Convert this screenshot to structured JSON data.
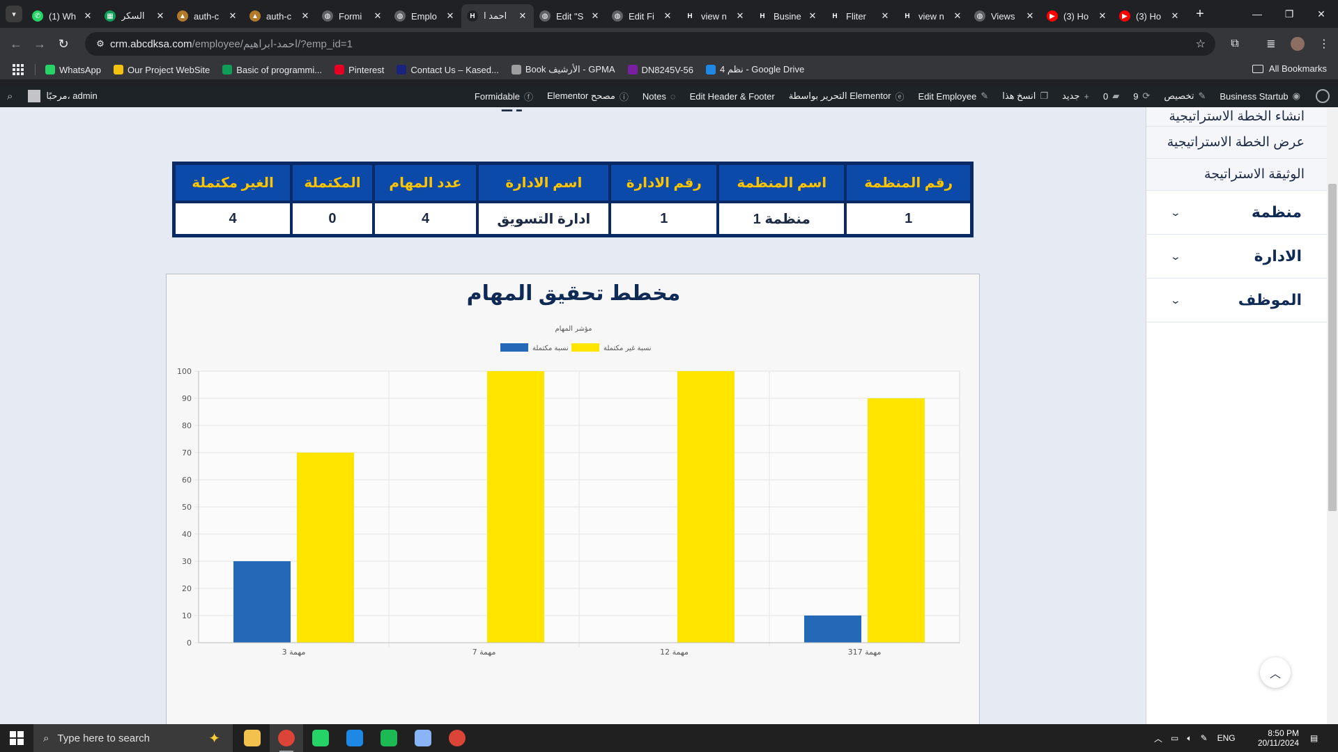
{
  "browser": {
    "tabs": [
      {
        "title": "(1) Wh",
        "icon": "whatsapp-icon",
        "color": "#25d366",
        "glyph": "✆"
      },
      {
        "title": "السكر",
        "icon": "sheets-icon",
        "color": "#0f9d58",
        "glyph": "▦"
      },
      {
        "title": "auth-c",
        "icon": "mountain-icon",
        "color": "#b07a2a",
        "glyph": "▲"
      },
      {
        "title": "auth-c",
        "icon": "mountain-icon",
        "color": "#b07a2a",
        "glyph": "▲"
      },
      {
        "title": "Formi",
        "icon": "globe-icon",
        "color": "#5f6368",
        "glyph": "◍"
      },
      {
        "title": "Emplo",
        "icon": "globe-icon",
        "color": "#5f6368",
        "glyph": "◍"
      },
      {
        "title": "احمد ا",
        "icon": "h-logo-icon",
        "color": "#202124",
        "glyph": "H",
        "active": true
      },
      {
        "title": "Edit \"S",
        "icon": "globe-icon",
        "color": "#5f6368",
        "glyph": "◍"
      },
      {
        "title": "Edit Fi",
        "icon": "globe-icon",
        "color": "#5f6368",
        "glyph": "◍"
      },
      {
        "title": "view n",
        "icon": "h-logo-icon",
        "color": "#202124",
        "glyph": "H"
      },
      {
        "title": "Busine",
        "icon": "h-logo-icon",
        "color": "#202124",
        "glyph": "H"
      },
      {
        "title": "Fliter",
        "icon": "h-logo-icon",
        "color": "#202124",
        "glyph": "H"
      },
      {
        "title": "view n",
        "icon": "h-logo-icon",
        "color": "#202124",
        "glyph": "H"
      },
      {
        "title": "Views",
        "icon": "globe-icon",
        "color": "#5f6368",
        "glyph": "◍"
      },
      {
        "title": "(3) Ho",
        "icon": "youtube-icon",
        "color": "#ff0000",
        "glyph": "▶"
      },
      {
        "title": "(3) Ho",
        "icon": "youtube-icon",
        "color": "#ff0000",
        "glyph": "▶"
      }
    ],
    "url_host": "crm.abcdksa.com",
    "url_path": "/employee/احمد-ابراهيم/?emp_id=1",
    "bookmarks": [
      {
        "label": "WhatsApp",
        "color": "#25d366"
      },
      {
        "label": "Our Project WebSite",
        "color": "#f4c20d"
      },
      {
        "label": "Basic of programmi...",
        "color": "#0f9d58"
      },
      {
        "label": "Pinterest",
        "color": "#e60023"
      },
      {
        "label": "Contact Us – Kased...",
        "color": "#1a237e"
      },
      {
        "label": "Book الأرشيف - GPMA",
        "color": "#9e9e9e"
      },
      {
        "label": "DN8245V-56",
        "color": "#7b1fa2"
      },
      {
        "label": "4 نظم - Google Drive",
        "color": "#1e88e5"
      }
    ],
    "all_bookmarks": "All Bookmarks"
  },
  "wp_admin_bar": {
    "greeting": "مرحبًا، admin",
    "items": [
      {
        "label": "Business Startub",
        "icon": "palette-icon"
      },
      {
        "label": "تخصيص",
        "icon": "brush-icon"
      },
      {
        "label": "9",
        "icon": "refresh-icon"
      },
      {
        "label": "0",
        "icon": "comment-icon"
      },
      {
        "label": "جديد",
        "icon": "plus-icon"
      },
      {
        "label": "انسخ هذا",
        "icon": "copy-icon"
      },
      {
        "label": "Edit Employee",
        "icon": "pencil-icon"
      },
      {
        "label": "التحرير بواسطة Elementor",
        "icon": "elementor-icon"
      },
      {
        "label": "Edit Header & Footer",
        "icon": ""
      },
      {
        "label": "Notes",
        "icon": "chat-icon"
      },
      {
        "label": "Elementor مصحح",
        "icon": "info-icon"
      },
      {
        "label": "Formidable",
        "icon": "formidable-icon"
      }
    ]
  },
  "sidebar": {
    "links": [
      "انشاء الخطة الاستراتيجية",
      "عرض الخطة الاستراتيجية",
      "الوثيقة الاستراتيجة"
    ],
    "groups": [
      "منظمة",
      "الادارة",
      "الموظف"
    ]
  },
  "summary_table": {
    "headers": [
      "رقم المنظمة",
      "اسم المنظمة",
      "رقم الادارة",
      "اسم الادارة",
      "عدد المهام",
      "المكتملة",
      "الغير مكتملة"
    ],
    "row": [
      "1",
      "منظمة 1",
      "1",
      "ادارة التسويق",
      "4",
      "0",
      "4"
    ]
  },
  "chart_card": {
    "heading": "مخطط تحقيق المهام"
  },
  "chart_data": {
    "type": "bar",
    "title": "مؤشر المهام",
    "categories": [
      "مهمة 3",
      "مهمة 7",
      "مهمة 12",
      "مهمة 317"
    ],
    "series": [
      {
        "name": "نسبة مكتملة",
        "color": "#2468b8",
        "values": [
          30,
          0,
          0,
          10
        ]
      },
      {
        "name": "نسبة غير مكتملة",
        "color": "#ffe500",
        "values": [
          70,
          100,
          100,
          90
        ]
      }
    ],
    "ylim": [
      0,
      100
    ],
    "yticks": [
      0,
      10,
      20,
      30,
      40,
      50,
      60,
      70,
      80,
      90,
      100
    ],
    "grid": true,
    "legend": "top-center"
  },
  "taskbar": {
    "search_placeholder": "Type here to search",
    "lang": "ENG",
    "time": "8:50 PM",
    "date": "20/11/2024",
    "apps": [
      {
        "name": "file-explorer-icon",
        "color": "#f2c14e",
        "running": false
      },
      {
        "name": "chrome-icon",
        "color": "#db4437",
        "running": true
      },
      {
        "name": "whatsapp-icon",
        "color": "#25d366",
        "running": false
      },
      {
        "name": "vscode-icon",
        "color": "#1e88e5",
        "running": false
      },
      {
        "name": "spotify-icon",
        "color": "#1db954",
        "running": false
      },
      {
        "name": "notepad-icon",
        "color": "#8ab4f8",
        "running": false
      },
      {
        "name": "chrome-canary-icon",
        "color": "#db4437",
        "running": false
      }
    ]
  }
}
